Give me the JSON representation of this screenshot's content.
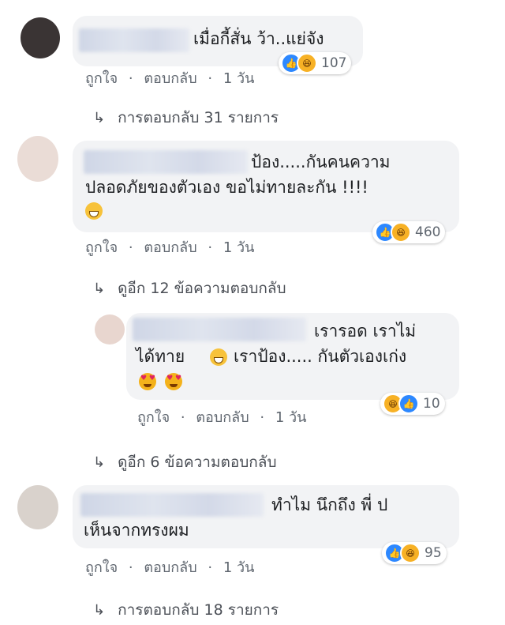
{
  "comments": [
    {
      "text_lines": [
        "เมื่อกี้สั่น ว้า..แย่จัง"
      ],
      "actions": {
        "like": "ถูกใจ",
        "reply": "ตอบกลับ",
        "time": "1 วัน",
        "sep": "·"
      },
      "reaction_count": "107",
      "replies_link": "การตอบกลับ 31 รายการ"
    },
    {
      "text_lines": [
        "ป้อง.....กันคนความ",
        "ปลอดภัยของตัวเอง ขอไม่ทายละกัน !!!!"
      ],
      "actions": {
        "like": "ถูกใจ",
        "reply": "ตอบกลับ",
        "time": "1 วัน",
        "sep": "·"
      },
      "reaction_count": "460",
      "replies_link": "ดูอีก 12 ข้อความตอบกลับ",
      "reply": {
        "text_lines": [
          "เรารอด เราไม่",
          "ได้ทาย",
          "เราป้อง..... กันตัวเองเก่ง"
        ],
        "actions": {
          "like": "ถูกใจ",
          "reply": "ตอบกลับ",
          "time": "1 วัน",
          "sep": "·"
        },
        "reaction_count": "10"
      },
      "more_replies_link": "ดูอีก 6 ข้อความตอบกลับ"
    },
    {
      "text_lines": [
        "ทำไม นึกถึง พี่ ป",
        "เห็นจากทรงผม"
      ],
      "actions": {
        "like": "ถูกใจ",
        "reply": "ตอบกลับ",
        "time": "1 วัน",
        "sep": "·"
      },
      "reaction_count": "95",
      "replies_link": "การตอบกลับ 18 รายการ"
    }
  ],
  "icons": {
    "reply_arrow": "reply-arrow-icon",
    "like": "like-icon",
    "haha": "haha-icon"
  },
  "colors": {
    "bubble": "#f2f3f5",
    "like_blue": "#2d88ff",
    "haha_yellow": "#f7b125",
    "meta_text": "#606770"
  }
}
